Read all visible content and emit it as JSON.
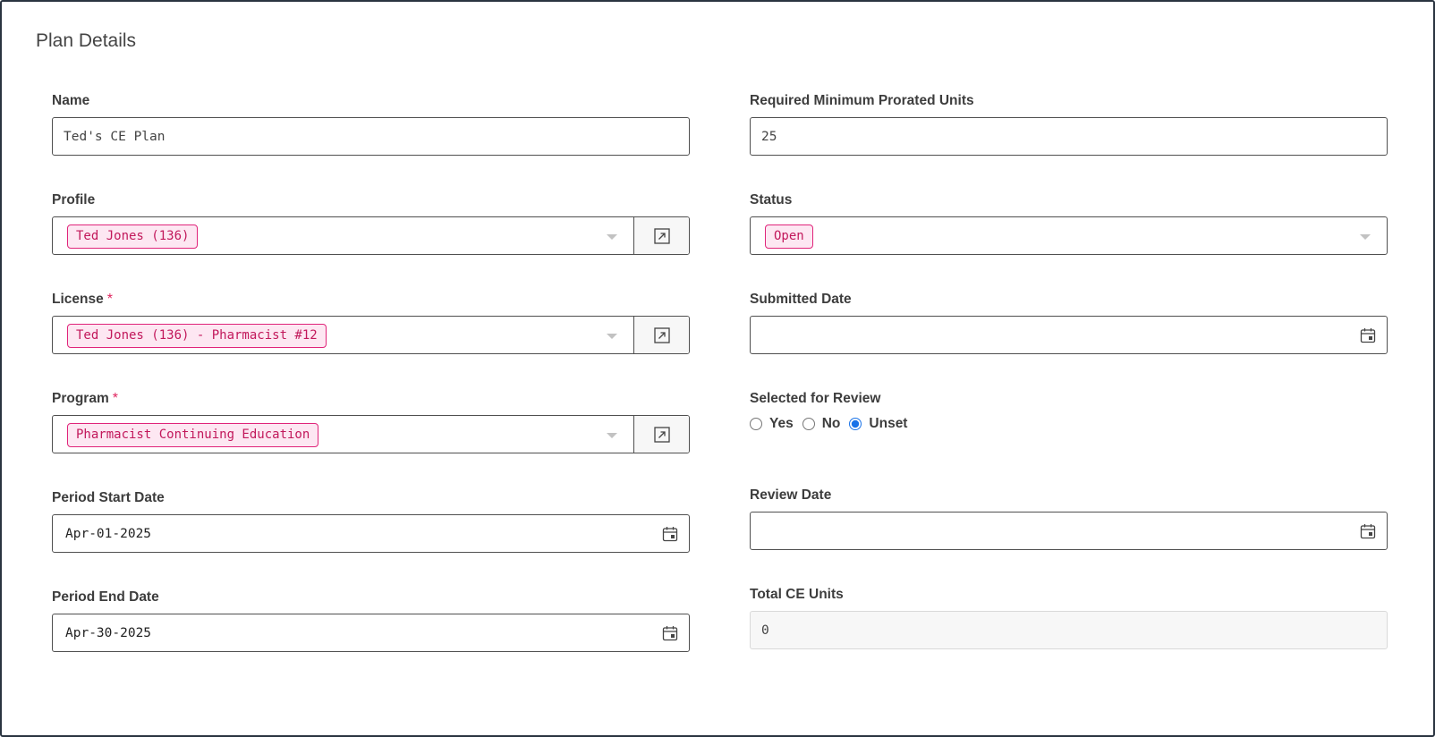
{
  "section": {
    "title": "Plan Details"
  },
  "fields": {
    "name": {
      "label": "Name",
      "value": "Ted's CE Plan"
    },
    "profile": {
      "label": "Profile",
      "value": "Ted Jones (136)"
    },
    "license": {
      "label": "License",
      "required_mark": "*",
      "value": "Ted Jones (136) - Pharmacist #12"
    },
    "program": {
      "label": "Program",
      "required_mark": "*",
      "value": "Pharmacist Continuing Education"
    },
    "period_start": {
      "label": "Period Start Date",
      "value": "Apr-01-2025"
    },
    "period_end": {
      "label": "Period End Date",
      "value": "Apr-30-2025"
    },
    "required_units": {
      "label": "Required Minimum Prorated Units",
      "value": "25"
    },
    "status": {
      "label": "Status",
      "value": "Open"
    },
    "submitted_date": {
      "label": "Submitted Date",
      "value": ""
    },
    "selected_for_review": {
      "label": "Selected for Review",
      "options": [
        "Yes",
        "No",
        "Unset"
      ],
      "selected": "Unset"
    },
    "review_date": {
      "label": "Review Date",
      "value": ""
    },
    "total_units": {
      "label": "Total CE Units",
      "value": "0"
    }
  },
  "icons": {
    "open_record": "external-link-icon",
    "date_picker": "calendar-icon",
    "dropdown": "chevron-down-icon"
  },
  "colors": {
    "tag_border": "#e0247a",
    "tag_background": "#fde7f2",
    "tag_text": "#c2185b",
    "required": "#e0245e",
    "radio_accent": "#1a73e8"
  }
}
